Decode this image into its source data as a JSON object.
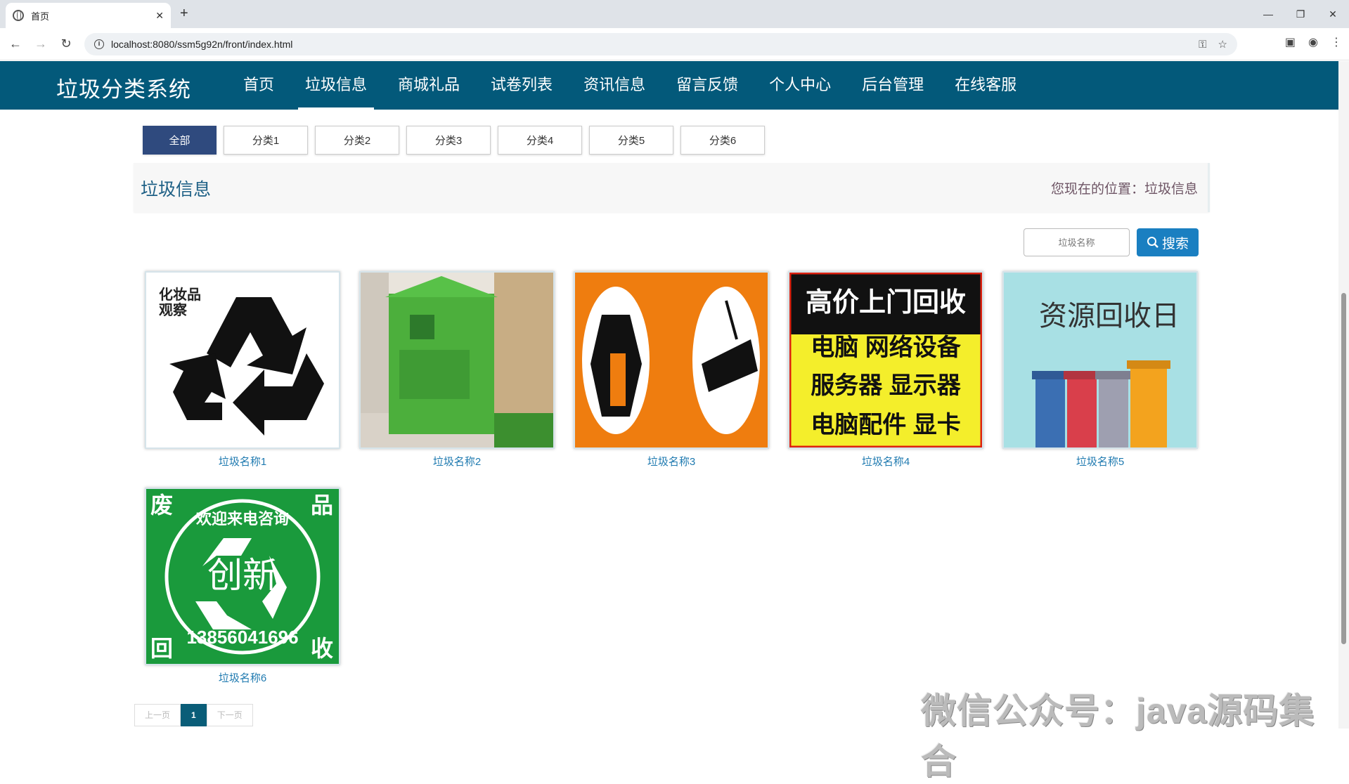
{
  "browser": {
    "tab_title": "首页",
    "url": "localhost:8080/ssm5g92n/front/index.html"
  },
  "site": {
    "logo": "垃圾分类系统",
    "nav": [
      "首页",
      "垃圾信息",
      "商城礼品",
      "试卷列表",
      "资讯信息",
      "留言反馈",
      "个人中心",
      "后台管理",
      "在线客服"
    ],
    "active_nav": "垃圾信息"
  },
  "categories": [
    "全部",
    "分类1",
    "分类2",
    "分类3",
    "分类4",
    "分类5",
    "分类6"
  ],
  "breadcrumb": {
    "title": "垃圾信息",
    "location": "您现在的位置：垃圾信息"
  },
  "search": {
    "placeholder": "垃圾名称",
    "button": "搜索"
  },
  "items": [
    {
      "name": "垃圾名称1",
      "image_text": [
        "化妆品",
        "观察"
      ]
    },
    {
      "name": "垃圾名称2",
      "image_text": []
    },
    {
      "name": "垃圾名称3",
      "image_text": []
    },
    {
      "name": "垃圾名称4",
      "image_text": [
        "高价上门回收",
        "电脑 网络设备",
        "服务器 显示器",
        "电脑配件 显卡"
      ]
    },
    {
      "name": "垃圾名称5",
      "image_text": [
        "资源回收日"
      ]
    },
    {
      "name": "垃圾名称6",
      "image_text": [
        "废",
        "品",
        "回",
        "收",
        "欢迎来电咨询",
        "创新",
        "13856041696"
      ]
    }
  ],
  "pager": {
    "prev": "上一页",
    "current": "1",
    "next": "下一页"
  },
  "watermark": "微信公众号：java源码集合",
  "colors": {
    "header": "#03597a",
    "accent": "#1a7fc1",
    "active_category": "#2f4a7e"
  }
}
